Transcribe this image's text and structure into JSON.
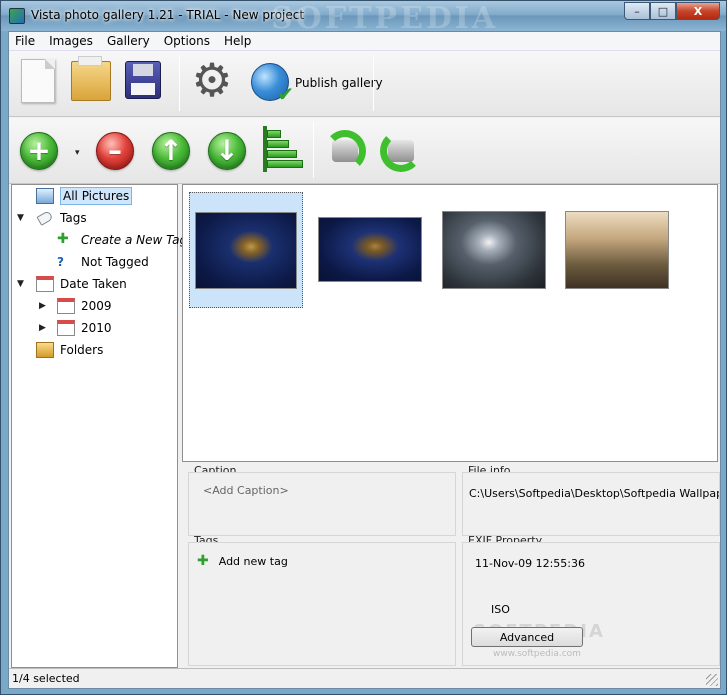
{
  "window": {
    "title": "Vista photo gallery 1.21 - TRIAL - New project",
    "watermark": "SOFTPEDIA",
    "minimize_label": "–",
    "maximize_label": "□",
    "close_label": "X"
  },
  "menu": [
    "File",
    "Images",
    "Gallery",
    "Options",
    "Help"
  ],
  "toolbar1": {
    "icons": [
      "new-document-icon",
      "open-folder-icon",
      "save-disk-icon",
      "settings-gear-icon",
      "publish-globe-icon"
    ],
    "publish_label": "Publish gallery"
  },
  "toolbar2": {
    "icons": [
      "add-icon",
      "dropdown-arrow-icon",
      "remove-icon",
      "move-up-icon",
      "move-down-icon",
      "align-icon",
      "rotate-left-icon",
      "rotate-right-icon"
    ],
    "add_glyph": "+",
    "remove_glyph": "–",
    "up_glyph": "↑",
    "down_glyph": "↓",
    "dropdown_glyph": "▾"
  },
  "tree": {
    "all_pictures": "All Pictures",
    "tags": "Tags",
    "create_new_tag": "Create a New Tag",
    "not_tagged": "Not Tagged",
    "date_taken": "Date Taken",
    "year_2009": "2009",
    "year_2010": "2010",
    "folders": "Folders",
    "expanded_glyph": "▼",
    "collapsed_glyph": "▶"
  },
  "thumbnails": {
    "count": 4,
    "selected_index": 0
  },
  "info": {
    "caption_title": "Caption",
    "caption_placeholder": "<Add Caption>",
    "fileinfo_title": "File info",
    "file_path": "C:\\Users\\Softpedia\\Desktop\\Softpedia Wallpapers\\",
    "tags_title": "Tags",
    "add_new_tag": "Add new tag",
    "exif_title": "EXIF Property",
    "exif_date": "11-Nov-09 12:55:36",
    "exif_iso": "ISO",
    "advanced_button": "Advanced",
    "watermark": "SOFTPEDIA",
    "watermark_url": "www.softpedia.com"
  },
  "status": {
    "text": "1/4 selected"
  }
}
